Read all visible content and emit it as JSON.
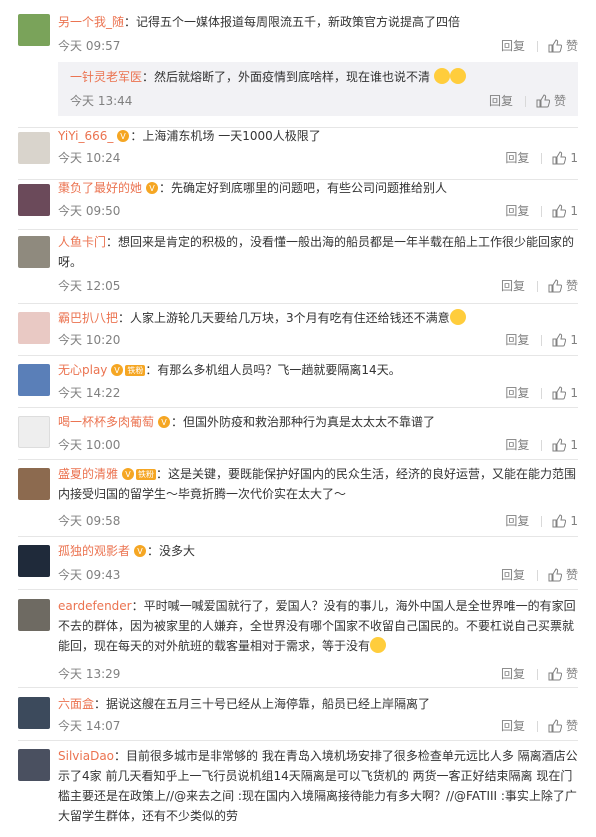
{
  "reply_label": "回复",
  "comments": [
    {
      "name": "另一个我_随",
      "text": "：记得五个一媒体报道每周限流五千，新政策官方说提高了四倍",
      "time": "今天 09:57",
      "like": "赞",
      "avatar_color": "#7aa35a",
      "nested": {
        "name": "一针灵老军医",
        "text": "：然后就熔断了，外面疫情到底啥样，现在谁也说不清",
        "time": "今天 13:44",
        "like": "赞"
      }
    },
    {
      "name": "YiYi_666_",
      "text": "：上海浦东机场 一天1000人极限了",
      "time": "今天 10:24",
      "like": "1",
      "avatar_color": "#d9d4cc"
    },
    {
      "name": "棗负了最好的她",
      "text": "：先确定好到底哪里的问题吧，有些公司问题推给别人",
      "time": "今天 09:50",
      "like": "1",
      "avatar_color": "#6b4a5a"
    },
    {
      "name": "人鱼卡门",
      "text": "：想回来是肯定的积极的，没看懂一般出海的船员都是一年半载在船上工作很少能回家的呀。",
      "time": "今天 12:05",
      "like": "赞",
      "avatar_color": "#8f8a7e"
    },
    {
      "name": "霸巴扒八把",
      "text": "：人家上游轮几天要给几万块，3个月有吃有住还给钱还不满意",
      "time": "今天 10:20",
      "like": "1",
      "avatar_color": "#e9c9c4"
    },
    {
      "name": "无心play",
      "fan": "铁粉",
      "text": "：有那么多机组人员吗？飞一趟就要隔离14天。",
      "time": "今天 14:22",
      "like": "1",
      "avatar_color": "#5a7fb8"
    },
    {
      "name": "喝一杯杯多肉葡萄",
      "text": "：但国外防疫和救治那种行为真是太太太不靠谱了",
      "time": "今天 10:00",
      "like": "1",
      "avatar_color": "#eeeeee"
    },
    {
      "name": "盛夏的清雅",
      "fan": "铁粉",
      "text": "：这是关键，要既能保护好国内的民众生活，经济的良好运营，又能在能力范围内接受归国的留学生～毕竟折腾一次代价实在太大了～",
      "time": "今天 09:58",
      "like": "1",
      "avatar_color": "#8c6a4f"
    },
    {
      "name": "孤独的观影者",
      "text": "：没多大",
      "time": "今天 09:43",
      "like": "赞",
      "avatar_color": "#1f2a3a"
    },
    {
      "name": "eardefender",
      "text": "：平时喊一喊爱国就行了，爱国人？没有的事儿，海外中国人是全世界唯一的有家回不去的群体，因为被家里的人嫌弃，全世界没有哪个国家不收留自己国民的。不要杠说自己买票就能回，现在每天的对外航班的载客量相对于需求，等于没有",
      "time": "今天 13:29",
      "like": "赞",
      "avatar_color": "#6e6a62"
    },
    {
      "name": "六面盒",
      "text": "：据说这艘在五月三十号已经从上海停靠，船员已经上岸隔离了",
      "time": "今天 14:07",
      "like": "赞",
      "avatar_color": "#3c4a5c"
    },
    {
      "name": "SilviaDao",
      "text": "：目前很多城市是非常够的 我在青岛入境机场安排了很多检查单元远比人多 隔离酒店公示了4家 前几天看知乎上一飞行员说机组14天隔离是可以飞货机的 两货一客正好结束隔离 现在门槛主要还是在政策上//@来去之间 :现在国内入境隔离接待能力有多大啊？//@FATIII :事实上除了广大留学生群体，还有不少类似的劳",
      "time": "",
      "like": "",
      "avatar_color": "#4a5060"
    }
  ]
}
